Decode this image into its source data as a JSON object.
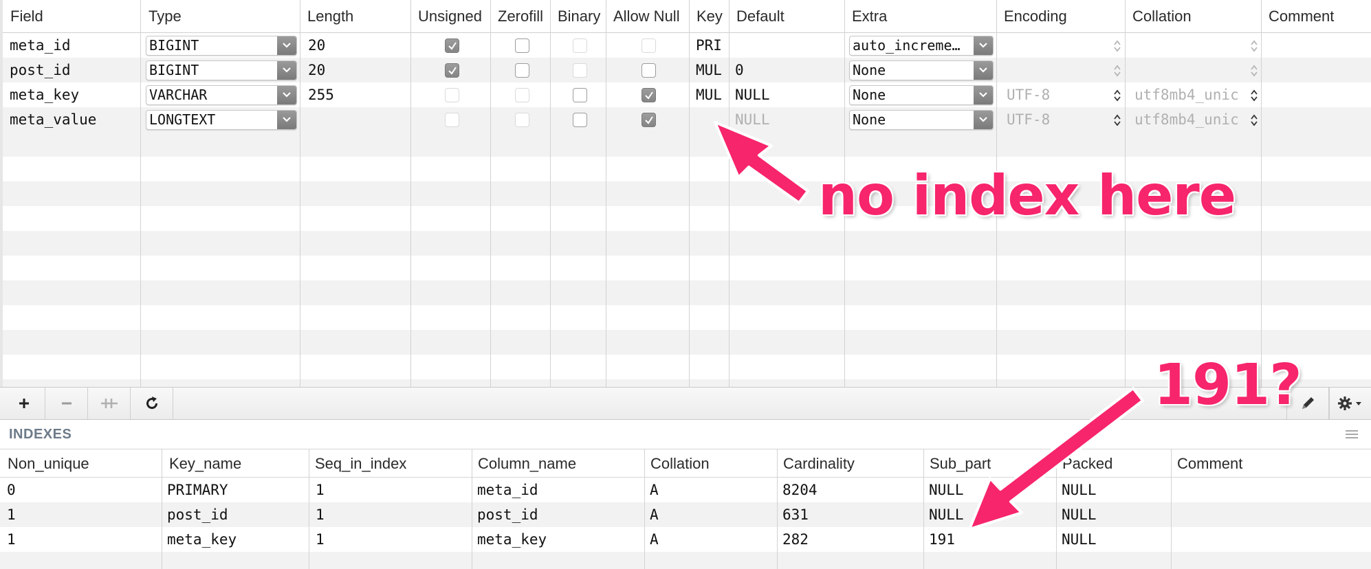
{
  "structure": {
    "columns": [
      "Field",
      "Type",
      "Length",
      "Unsigned",
      "Zerofill",
      "Binary",
      "Allow Null",
      "Key",
      "Default",
      "Extra",
      "Encoding",
      "Collation",
      "Comment"
    ],
    "rows": [
      {
        "field": "meta_id",
        "type": "BIGINT",
        "length": "20",
        "unsigned": true,
        "unsigned_enabled": true,
        "zerofill": false,
        "zerofill_enabled": true,
        "binary": false,
        "binary_enabled": false,
        "allow_null": false,
        "allow_null_enabled": false,
        "key": "PRI",
        "default": "",
        "extra": "auto_increme…",
        "encoding": "",
        "collation": ""
      },
      {
        "field": "post_id",
        "type": "BIGINT",
        "length": "20",
        "unsigned": true,
        "unsigned_enabled": true,
        "zerofill": false,
        "zerofill_enabled": true,
        "binary": false,
        "binary_enabled": false,
        "allow_null": false,
        "allow_null_enabled": true,
        "key": "MUL",
        "default": "0",
        "extra": "None",
        "encoding": "",
        "collation": ""
      },
      {
        "field": "meta_key",
        "type": "VARCHAR",
        "length": "255",
        "unsigned": false,
        "unsigned_enabled": false,
        "zerofill": false,
        "zerofill_enabled": false,
        "binary": false,
        "binary_enabled": true,
        "allow_null": true,
        "allow_null_enabled": true,
        "key": "MUL",
        "default": "NULL",
        "extra": "None",
        "encoding": "UTF-8",
        "collation": "utf8mb4_unic"
      },
      {
        "field": "meta_value",
        "type": "LONGTEXT",
        "length": "",
        "unsigned": false,
        "unsigned_enabled": false,
        "zerofill": false,
        "zerofill_enabled": false,
        "binary": false,
        "binary_enabled": true,
        "allow_null": true,
        "allow_null_enabled": true,
        "key": "",
        "default": "NULL",
        "default_dim": true,
        "extra": "None",
        "encoding": "UTF-8",
        "collation": "utf8mb4_unic"
      }
    ]
  },
  "toolbar": {
    "add_icon": "plus-icon",
    "remove_icon": "minus-icon",
    "duplicate_icon": "duplicate-icon",
    "refresh_icon": "refresh-icon",
    "edit_icon": "pencil-icon",
    "settings_icon": "gear-icon"
  },
  "indexes": {
    "title": "INDEXES",
    "columns": [
      "Non_unique",
      "Key_name",
      "Seq_in_index",
      "Column_name",
      "Collation",
      "Cardinality",
      "Sub_part",
      "Packed",
      "Comment"
    ],
    "rows": [
      {
        "non_unique": "0",
        "key_name": "PRIMARY",
        "seq": "1",
        "column_name": "meta_id",
        "collation": "A",
        "cardinality": "8204",
        "sub_part": "NULL",
        "packed": "NULL",
        "comment": ""
      },
      {
        "non_unique": "1",
        "key_name": "post_id",
        "seq": "1",
        "column_name": "post_id",
        "collation": "A",
        "cardinality": "631",
        "sub_part": "NULL",
        "packed": "NULL",
        "comment": ""
      },
      {
        "non_unique": "1",
        "key_name": "meta_key",
        "seq": "1",
        "column_name": "meta_key",
        "collation": "A",
        "cardinality": "282",
        "sub_part": "191",
        "packed": "NULL",
        "comment": ""
      }
    ]
  },
  "annotations": {
    "no_index": "no index here",
    "question": "191?",
    "color": "#f7256b"
  }
}
